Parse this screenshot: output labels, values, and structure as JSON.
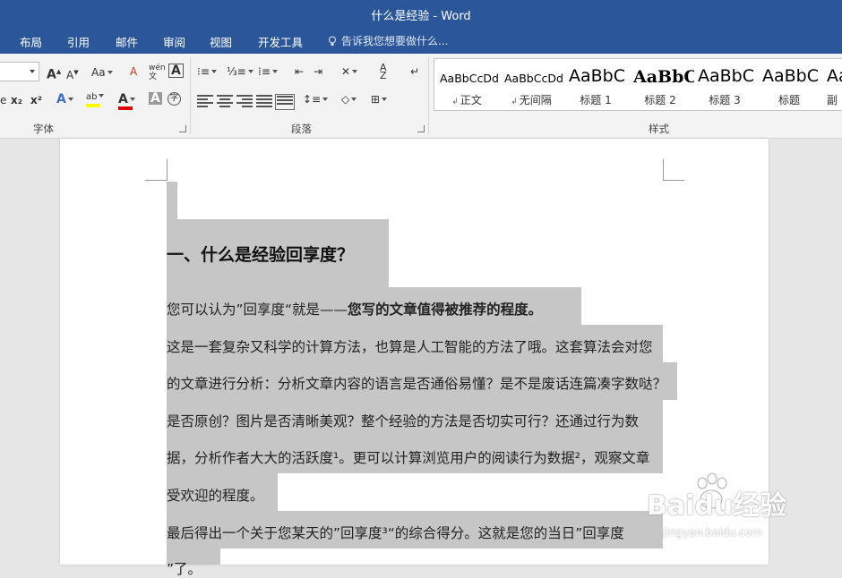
{
  "window": {
    "title": "什么是经验 - Word"
  },
  "menu": {
    "tabs": [
      "布局",
      "引用",
      "邮件",
      "审阅",
      "视图",
      "开发工具"
    ],
    "tell_me": "告诉我您想要做什么..."
  },
  "ribbon": {
    "groups": {
      "font": "字体",
      "paragraph": "段落",
      "styles": "样式"
    },
    "font_buttons": {
      "grow": "A",
      "shrink": "A",
      "case": "Aa",
      "phonetic": "wén",
      "subscript": "x₂",
      "superscript": "x²"
    },
    "styles": [
      {
        "sample": "AaBbCcDd",
        "name": "正文",
        "marked": true
      },
      {
        "sample": "AaBbCcDd",
        "name": "无间隔",
        "marked": true
      },
      {
        "sample": "AaBbC",
        "name": "标题 1",
        "marked": false
      },
      {
        "sample": "AaBbC",
        "name": "标题 2",
        "marked": false
      },
      {
        "sample": "AaBbC",
        "name": "标题 3",
        "marked": false
      },
      {
        "sample": "AaBbC",
        "name": "标题",
        "marked": false
      },
      {
        "sample": "Aa",
        "name": "副",
        "marked": false
      }
    ],
    "colors": {
      "highlight": "#ffff00",
      "font_color": "#e00000",
      "accent": "#2b579a"
    }
  },
  "document": {
    "heading": "一、什么是经验回享度？",
    "p1_plain": "您可以认为”回享度“就是——",
    "p1_bold": "您写的文章值得被推荐的程度。",
    "lines": [
      "这是一套复杂又科学的计算方法，也算是人工智能的方法了哦。这套算法会对您",
      "的文章进行分析：分析文章内容的语言是否通俗易懂？是不是废话连篇凑字数哒？",
      "是否原创？图片是否清晰美观？整个经验的方法是否切实可行？还通过行为数",
      "据，分析作者大大的活跃度¹。更可以计算浏览用户的阅读行为数据²，观察文章",
      "受欢迎的程度。",
      "最后得出一个关于您某天的”回享度³“的综合得分。这就是您的当日”回享度",
      "”了。"
    ]
  },
  "watermark": {
    "logo": "Baidu经验",
    "url": "jingyan.baidu.com"
  }
}
